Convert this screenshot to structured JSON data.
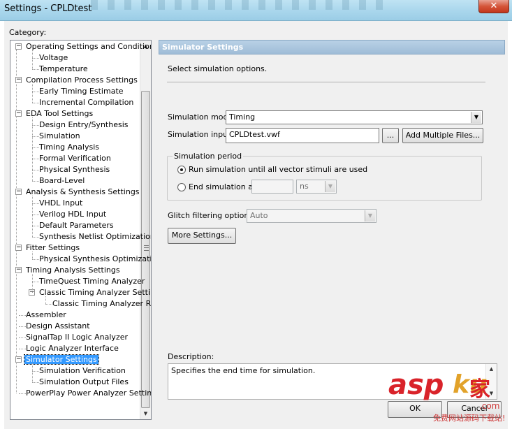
{
  "window": {
    "title": "Settings - CPLDtest",
    "close_glyph": "✕"
  },
  "category_label": "Category:",
  "tree": [
    {
      "label": "Operating Settings and Conditions",
      "level": 0,
      "expander": "−"
    },
    {
      "label": "Voltage",
      "level": 1
    },
    {
      "label": "Temperature",
      "level": 1
    },
    {
      "label": "Compilation Process Settings",
      "level": 0,
      "expander": "−"
    },
    {
      "label": "Early Timing Estimate",
      "level": 1
    },
    {
      "label": "Incremental Compilation",
      "level": 1
    },
    {
      "label": "EDA Tool Settings",
      "level": 0,
      "expander": "−"
    },
    {
      "label": "Design Entry/Synthesis",
      "level": 1
    },
    {
      "label": "Simulation",
      "level": 1
    },
    {
      "label": "Timing Analysis",
      "level": 1
    },
    {
      "label": "Formal Verification",
      "level": 1
    },
    {
      "label": "Physical Synthesis",
      "level": 1
    },
    {
      "label": "Board-Level",
      "level": 1
    },
    {
      "label": "Analysis & Synthesis Settings",
      "level": 0,
      "expander": "−"
    },
    {
      "label": "VHDL Input",
      "level": 1
    },
    {
      "label": "Verilog HDL Input",
      "level": 1
    },
    {
      "label": "Default Parameters",
      "level": 1
    },
    {
      "label": "Synthesis Netlist Optimizations",
      "level": 1
    },
    {
      "label": "Fitter Settings",
      "level": 0,
      "expander": "−"
    },
    {
      "label": "Physical Synthesis Optimizations",
      "level": 1
    },
    {
      "label": "Timing Analysis Settings",
      "level": 0,
      "expander": "−"
    },
    {
      "label": "TimeQuest Timing Analyzer",
      "level": 1
    },
    {
      "label": "Classic Timing Analyzer Settings",
      "level": 1,
      "expander": "−"
    },
    {
      "label": "Classic Timing Analyzer Reports",
      "level": 2
    },
    {
      "label": "Assembler",
      "level": 0
    },
    {
      "label": "Design Assistant",
      "level": 0
    },
    {
      "label": "SignalTap II Logic Analyzer",
      "level": 0
    },
    {
      "label": "Logic Analyzer Interface",
      "level": 0
    },
    {
      "label": "Simulator Settings",
      "level": 0,
      "expander": "−",
      "selected": true
    },
    {
      "label": "Simulation Verification",
      "level": 1
    },
    {
      "label": "Simulation Output Files",
      "level": 1
    },
    {
      "label": "PowerPlay Power Analyzer Settings",
      "level": 0
    }
  ],
  "panel": {
    "header": "Simulator Settings",
    "intro": "Select simulation options.",
    "mode_label": "Simulation mode:",
    "mode_value": "Timing",
    "input_label": "Simulation input:",
    "input_value": "CPLDtest.vwf",
    "browse_label": "...",
    "add_files_label": "Add Multiple Files...",
    "period_legend": "Simulation period",
    "run_until_label": "Run simulation until all vector stimuli are used",
    "run_until_selected": true,
    "end_at_label": "End simulation at:",
    "end_at_value": "",
    "end_unit": "ns",
    "glitch_label": "Glitch filtering options:",
    "glitch_value": "Auto",
    "more_settings_label": "More Settings...",
    "description_label": "Description:",
    "description_text": "Specifies the end time for simulation."
  },
  "footer": {
    "ok_label": "OK",
    "cancel_label": "Cancel"
  },
  "watermark": {
    "brand_a": "asp",
    "brand_b": "ku",
    "brand_cn": "家",
    "domain": ".com",
    "slogan": "免费网站源码下载站!"
  }
}
